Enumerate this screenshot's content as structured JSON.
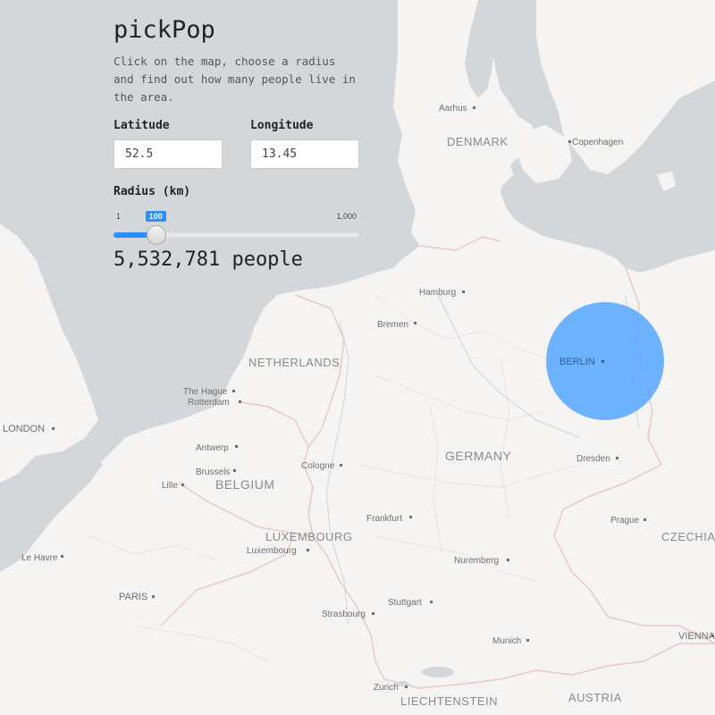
{
  "app": {
    "title": "pickPop",
    "description": "Click on the map, choose a radius and find out how many people live in the area.",
    "result_text": "5,532,781 people"
  },
  "inputs": {
    "latitude": {
      "label": "Latitude",
      "value": "52.5"
    },
    "longitude": {
      "label": "Longitude",
      "value": "13.45"
    }
  },
  "radius": {
    "label": "Radius (km)",
    "min_label": "1",
    "max_label": "1,000",
    "value_label": "100",
    "min": 1,
    "max": 1000,
    "value": 100
  },
  "colors": {
    "accent": "#2c8dff",
    "circle": "#5aa8ff",
    "water": "#d4d7da",
    "land": "#f5f4f2",
    "border": "#e7c9cc"
  },
  "map": {
    "countries": [
      "DENMARK",
      "NETHERLANDS",
      "BELGIUM",
      "GERMANY",
      "LUXEMBOURG",
      "CZECHIA",
      "AUSTRIA",
      "LIECHTENSTEIN"
    ],
    "cities": [
      "Aarhus",
      "Copenhagen",
      "Hamburg",
      "Bremen",
      "BERLIN",
      "The Hague",
      "Rotterdam",
      "LONDON",
      "Antwerp",
      "Brussels",
      "Cologne",
      "Lille",
      "Dresden",
      "Frankfurt",
      "Prague",
      "Le Havre",
      "Luxembourg",
      "Nuremberg",
      "PARIS",
      "Stuttgart",
      "Strasbourg",
      "Munich",
      "Zurich",
      "VIENNA"
    ]
  }
}
